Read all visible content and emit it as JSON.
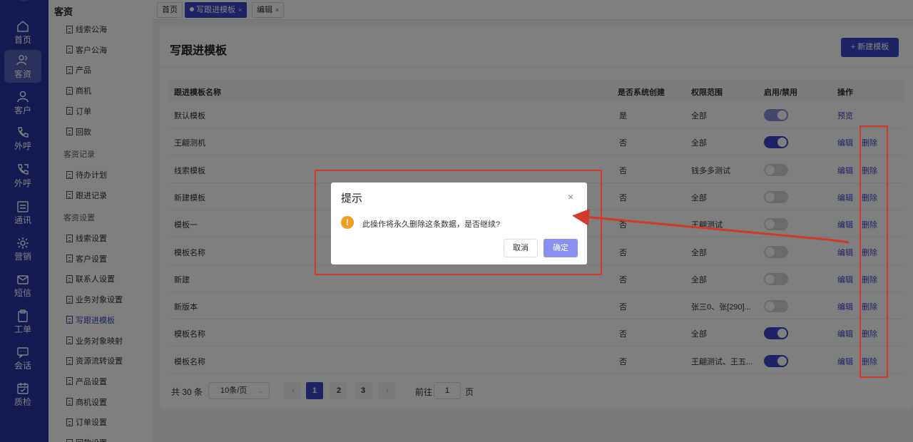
{
  "rail": {
    "items": [
      {
        "label": "首页",
        "icon": "home-icon"
      },
      {
        "label": "客资",
        "icon": "users-icon",
        "active": true
      },
      {
        "label": "客户",
        "icon": "user-icon"
      },
      {
        "label": "外呼",
        "icon": "phone-call-icon"
      },
      {
        "label": "外呼",
        "icon": "phone-out-icon"
      },
      {
        "label": "通讯",
        "icon": "contacts-icon"
      },
      {
        "label": "营销",
        "icon": "gear-icon"
      },
      {
        "label": "短信",
        "icon": "message-icon"
      },
      {
        "label": "工单",
        "icon": "clipboard-icon"
      },
      {
        "label": "会话",
        "icon": "chat-icon"
      },
      {
        "label": "质检",
        "icon": "calendar-check-icon"
      }
    ]
  },
  "submenu": {
    "title": "客资",
    "items": [
      "线索公海",
      "客户公海",
      "产品",
      "商机",
      "订单",
      "回款"
    ],
    "group1": "客资记录",
    "items2": [
      "待办计划",
      "跟进记录"
    ],
    "group2": "客资设置",
    "items3": [
      "线索设置",
      "客户设置",
      "联系人设置",
      "业务对象设置",
      "写跟进模板",
      "业务对象映射",
      "资源流转设置",
      "产品设置",
      "商机设置",
      "订单设置",
      "回款设置"
    ]
  },
  "tabs": [
    {
      "label": "首页"
    },
    {
      "label": "写跟进模板",
      "close": "×",
      "active": true
    },
    {
      "label": "编辑",
      "close": "×"
    }
  ],
  "page": {
    "title": "写跟进模板",
    "new_button": "+ 新建模板"
  },
  "table": {
    "headers": [
      "跟进模板名称",
      "是否系统创建",
      "权限范围",
      "启用/禁用",
      "操作"
    ],
    "rows": [
      {
        "name": "默认模板",
        "system": "是",
        "scope": "全部",
        "enabled": true,
        "ops": [
          "预览"
        ]
      },
      {
        "name": "王翩测机",
        "system": "否",
        "scope": "全部",
        "enabled": true,
        "ops": [
          "编辑",
          "删除"
        ]
      },
      {
        "name": "线索模板",
        "system": "否",
        "scope": "钱多多测试",
        "enabled": false,
        "ops": [
          "编辑",
          "删除"
        ]
      },
      {
        "name": "新建模板",
        "system": "否",
        "scope": "全部",
        "enabled": false,
        "ops": [
          "编辑",
          "删除"
        ]
      },
      {
        "name": "模板一",
        "system": "否",
        "scope": "王翩测试",
        "enabled": false,
        "ops": [
          "编辑",
          "删除"
        ]
      },
      {
        "name": "模板名称",
        "system": "否",
        "scope": "全部",
        "enabled": false,
        "ops": [
          "编辑",
          "删除"
        ]
      },
      {
        "name": "新建",
        "system": "否",
        "scope": "全部",
        "enabled": false,
        "ops": [
          "编辑",
          "删除"
        ]
      },
      {
        "name": "新版本",
        "system": "否",
        "scope": "张三0、张[290]...",
        "enabled": false,
        "ops": [
          "编辑",
          "删除"
        ]
      },
      {
        "name": "模板名称",
        "system": "否",
        "scope": "全部",
        "enabled": true,
        "ops": [
          "编辑",
          "删除"
        ]
      },
      {
        "name": "模板名称",
        "system": "否",
        "scope": "王翩测试、王五...",
        "enabled": true,
        "ops": [
          "编辑",
          "删除"
        ]
      }
    ]
  },
  "pagination": {
    "total": "共 30 条",
    "page_size": "10条/页",
    "pages": [
      "1",
      "2",
      "3"
    ],
    "current": "1",
    "goto_label": "前往",
    "goto_value": "1",
    "page_suffix": "页"
  },
  "dialog": {
    "title": "提示",
    "close": "×",
    "message": "此操作将永久删除这条数据，是否继续?",
    "cancel": "取消",
    "confirm": "确定"
  },
  "colors": {
    "primary": "#3b47c9",
    "rail": "#2b35a6",
    "annotation": "#d43a2a",
    "warning": "#f0a020"
  }
}
